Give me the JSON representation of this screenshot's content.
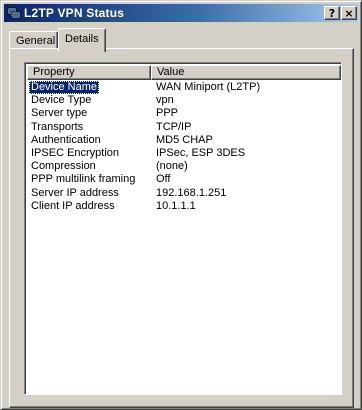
{
  "window": {
    "title": "L2TP VPN Status",
    "help_label": "?",
    "close_label": "×"
  },
  "tabs": [
    {
      "label": "General",
      "active": false
    },
    {
      "label": "Details",
      "active": true
    }
  ],
  "listview": {
    "columns": [
      "Property",
      "Value"
    ],
    "rows": [
      {
        "property": "Device Name",
        "value": "WAN Miniport (L2TP)",
        "selected": true
      },
      {
        "property": "Device Type",
        "value": "vpn"
      },
      {
        "property": "Server type",
        "value": "PPP"
      },
      {
        "property": "Transports",
        "value": "TCP/IP"
      },
      {
        "property": "Authentication",
        "value": "MD5 CHAP"
      },
      {
        "property": "IPSEC Encryption",
        "value": "IPSec, ESP 3DES"
      },
      {
        "property": "Compression",
        "value": "(none)"
      },
      {
        "property": "PPP multilink framing",
        "value": "Off"
      },
      {
        "property": "Server IP address",
        "value": "192.168.1.251"
      },
      {
        "property": "Client IP address",
        "value": "10.1.1.1"
      }
    ]
  },
  "colors": {
    "titlebar_start": "#0a246a",
    "titlebar_end": "#a6caf0",
    "selection": "#0a246a",
    "face": "#d4d0c8"
  },
  "icons": {
    "title_icon": "network-connection-icon"
  }
}
